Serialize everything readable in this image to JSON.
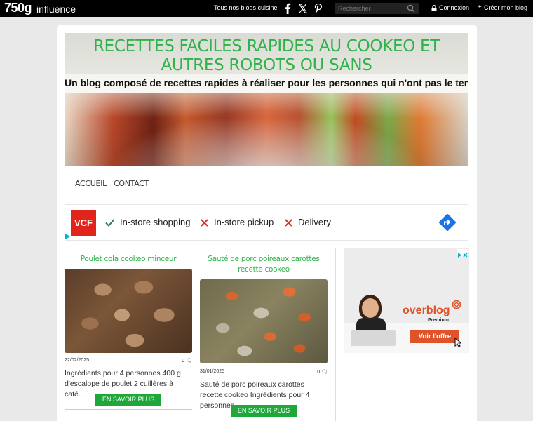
{
  "topbar": {
    "logo": "750g",
    "logo_sub": "influence",
    "blogs_link": "Tous nos blogs cuisine",
    "search_placeholder": "Rechercher",
    "login": "Connexion",
    "create": "Créer mon blog"
  },
  "blog": {
    "title": "RECETTES FACILES RAPIDES AU COOKEO ET AUTRES ROBOTS OU SANS",
    "description": "Un blog composé de recettes rapides à réaliser pour les personnes qui n'ont pas le temps et faciles p..."
  },
  "nav": {
    "home": "ACCUEIL",
    "contact": "CONTACT"
  },
  "ad": {
    "brand": "VCF",
    "features": [
      "In-store shopping",
      "In-store pickup",
      "Delivery"
    ]
  },
  "posts": [
    {
      "title": "Poulet cola cookeo minceur",
      "date": "22/02/2025",
      "comments": "0",
      "excerpt": "Ingrédients pour 4 personnes 400 g d'escalope de poulet 2 cuillères à café...",
      "button": "EN SAVOIR PLUS"
    },
    {
      "title": "Sauté de porc poireaux carottes recette cookeo",
      "date": "31/01/2025",
      "comments": "0",
      "excerpt": "Sauté de porc poireaux carottes recette cookeo Ingrédients pour 4 personnes...",
      "button": "EN SAVOIR PLUS"
    }
  ],
  "side_ad": {
    "brand": "overblog",
    "tier": "Premium",
    "cta": "Voir l'offre"
  },
  "colors": {
    "accent_green": "#2fb24a",
    "button_green": "#1fa83a",
    "overblog_orange": "#e0522a"
  }
}
